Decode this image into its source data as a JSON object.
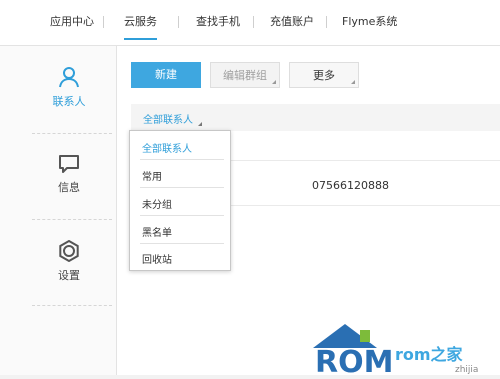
{
  "nav": {
    "items": [
      "应用中心",
      "云服务",
      "查找手机",
      "充值账户",
      "Flyme系统"
    ],
    "active": "云服务"
  },
  "sidebar": {
    "items": [
      {
        "label": "联系人",
        "icon": "person-icon"
      },
      {
        "label": "信息",
        "icon": "message-icon"
      },
      {
        "label": "设置",
        "icon": "gear-icon"
      }
    ]
  },
  "toolbar": {
    "new_label": "新建",
    "edit_group_label": "编辑群组",
    "more_label": "更多"
  },
  "filter": {
    "label": "全部联系人"
  },
  "contacts": [
    {
      "phone": "07566120888"
    }
  ],
  "dropdown": {
    "options": [
      "全部联系人",
      "常用",
      "未分组",
      "黑名单",
      "回收站"
    ],
    "selected": "全部联系人"
  },
  "watermark": {
    "text1": "ROM",
    "text2": "rom之家",
    "text3": "zhijia"
  },
  "colors": {
    "accent": "#2f9ed9",
    "primary_button": "#3ea7e0",
    "logo_blue": "#2a6fb3"
  }
}
